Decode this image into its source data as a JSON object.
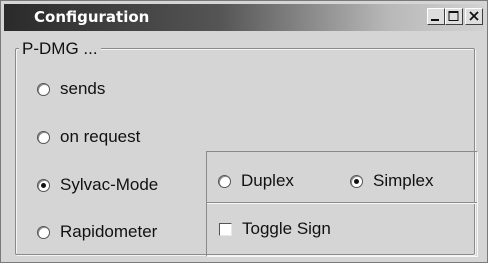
{
  "window": {
    "title": "Configuration",
    "controls": {
      "minimize": "minimize-icon",
      "maximize": "maximize-icon",
      "close": "close-icon"
    }
  },
  "group": {
    "label": "P-DMG ...",
    "options": [
      {
        "label": "sends",
        "selected": false
      },
      {
        "label": "on request",
        "selected": false
      },
      {
        "label": "Sylvac-Mode",
        "selected": true
      },
      {
        "label": "Rapidometer",
        "selected": false
      }
    ]
  },
  "mode_panel": {
    "duplex_label": "Duplex",
    "duplex_selected": false,
    "simplex_label": "Simplex",
    "simplex_selected": true,
    "toggle_sign_label": "Toggle Sign",
    "toggle_sign_checked": false
  }
}
